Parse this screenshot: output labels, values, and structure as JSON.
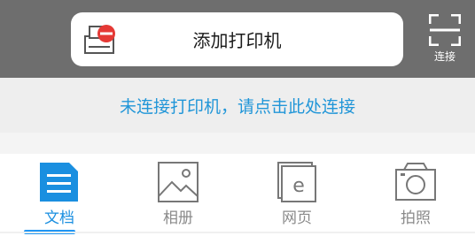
{
  "header": {
    "add_printer_label": "添加打印机",
    "connect_label": "连接",
    "icons": {
      "printer": "printer-add-icon",
      "scan": "scan-frame-icon"
    }
  },
  "notice": {
    "text": "未连接打印机，请点击此处连接"
  },
  "tabs": [
    {
      "label": "文档",
      "icon": "document-icon",
      "active": true
    },
    {
      "label": "相册",
      "icon": "photo-album-icon",
      "active": false
    },
    {
      "label": "网页",
      "icon": "web-page-icon",
      "active": false
    },
    {
      "label": "拍照",
      "icon": "camera-icon",
      "active": false
    }
  ],
  "colors": {
    "header_bg": "#6e6e6e",
    "accent": "#2196f3",
    "notice_text": "#2196d8",
    "badge_red": "#e53935"
  }
}
